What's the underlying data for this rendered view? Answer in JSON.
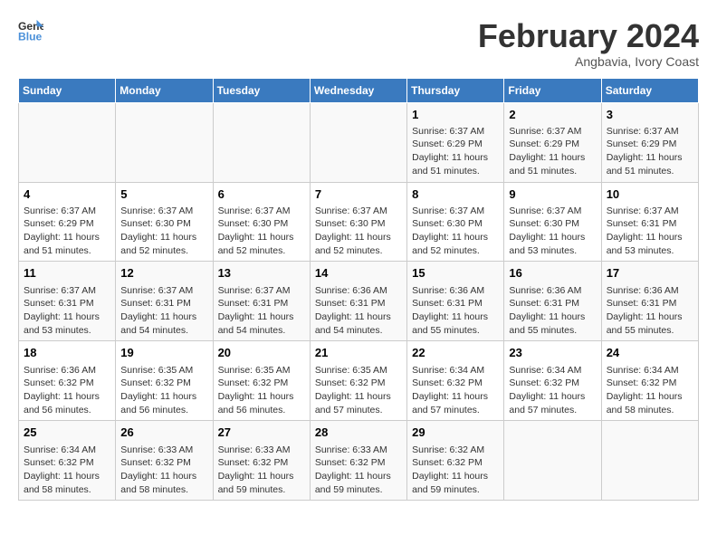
{
  "logo": {
    "line1": "General",
    "line2": "Blue"
  },
  "title": "February 2024",
  "subtitle": "Angbavia, Ivory Coast",
  "days_of_week": [
    "Sunday",
    "Monday",
    "Tuesday",
    "Wednesday",
    "Thursday",
    "Friday",
    "Saturday"
  ],
  "weeks": [
    [
      {
        "day": "",
        "info": ""
      },
      {
        "day": "",
        "info": ""
      },
      {
        "day": "",
        "info": ""
      },
      {
        "day": "",
        "info": ""
      },
      {
        "day": "1",
        "info": "Sunrise: 6:37 AM\nSunset: 6:29 PM\nDaylight: 11 hours and 51 minutes."
      },
      {
        "day": "2",
        "info": "Sunrise: 6:37 AM\nSunset: 6:29 PM\nDaylight: 11 hours and 51 minutes."
      },
      {
        "day": "3",
        "info": "Sunrise: 6:37 AM\nSunset: 6:29 PM\nDaylight: 11 hours and 51 minutes."
      }
    ],
    [
      {
        "day": "4",
        "info": "Sunrise: 6:37 AM\nSunset: 6:29 PM\nDaylight: 11 hours and 51 minutes."
      },
      {
        "day": "5",
        "info": "Sunrise: 6:37 AM\nSunset: 6:30 PM\nDaylight: 11 hours and 52 minutes."
      },
      {
        "day": "6",
        "info": "Sunrise: 6:37 AM\nSunset: 6:30 PM\nDaylight: 11 hours and 52 minutes."
      },
      {
        "day": "7",
        "info": "Sunrise: 6:37 AM\nSunset: 6:30 PM\nDaylight: 11 hours and 52 minutes."
      },
      {
        "day": "8",
        "info": "Sunrise: 6:37 AM\nSunset: 6:30 PM\nDaylight: 11 hours and 52 minutes."
      },
      {
        "day": "9",
        "info": "Sunrise: 6:37 AM\nSunset: 6:30 PM\nDaylight: 11 hours and 53 minutes."
      },
      {
        "day": "10",
        "info": "Sunrise: 6:37 AM\nSunset: 6:31 PM\nDaylight: 11 hours and 53 minutes."
      }
    ],
    [
      {
        "day": "11",
        "info": "Sunrise: 6:37 AM\nSunset: 6:31 PM\nDaylight: 11 hours and 53 minutes."
      },
      {
        "day": "12",
        "info": "Sunrise: 6:37 AM\nSunset: 6:31 PM\nDaylight: 11 hours and 54 minutes."
      },
      {
        "day": "13",
        "info": "Sunrise: 6:37 AM\nSunset: 6:31 PM\nDaylight: 11 hours and 54 minutes."
      },
      {
        "day": "14",
        "info": "Sunrise: 6:36 AM\nSunset: 6:31 PM\nDaylight: 11 hours and 54 minutes."
      },
      {
        "day": "15",
        "info": "Sunrise: 6:36 AM\nSunset: 6:31 PM\nDaylight: 11 hours and 55 minutes."
      },
      {
        "day": "16",
        "info": "Sunrise: 6:36 AM\nSunset: 6:31 PM\nDaylight: 11 hours and 55 minutes."
      },
      {
        "day": "17",
        "info": "Sunrise: 6:36 AM\nSunset: 6:31 PM\nDaylight: 11 hours and 55 minutes."
      }
    ],
    [
      {
        "day": "18",
        "info": "Sunrise: 6:36 AM\nSunset: 6:32 PM\nDaylight: 11 hours and 56 minutes."
      },
      {
        "day": "19",
        "info": "Sunrise: 6:35 AM\nSunset: 6:32 PM\nDaylight: 11 hours and 56 minutes."
      },
      {
        "day": "20",
        "info": "Sunrise: 6:35 AM\nSunset: 6:32 PM\nDaylight: 11 hours and 56 minutes."
      },
      {
        "day": "21",
        "info": "Sunrise: 6:35 AM\nSunset: 6:32 PM\nDaylight: 11 hours and 57 minutes."
      },
      {
        "day": "22",
        "info": "Sunrise: 6:34 AM\nSunset: 6:32 PM\nDaylight: 11 hours and 57 minutes."
      },
      {
        "day": "23",
        "info": "Sunrise: 6:34 AM\nSunset: 6:32 PM\nDaylight: 11 hours and 57 minutes."
      },
      {
        "day": "24",
        "info": "Sunrise: 6:34 AM\nSunset: 6:32 PM\nDaylight: 11 hours and 58 minutes."
      }
    ],
    [
      {
        "day": "25",
        "info": "Sunrise: 6:34 AM\nSunset: 6:32 PM\nDaylight: 11 hours and 58 minutes."
      },
      {
        "day": "26",
        "info": "Sunrise: 6:33 AM\nSunset: 6:32 PM\nDaylight: 11 hours and 58 minutes."
      },
      {
        "day": "27",
        "info": "Sunrise: 6:33 AM\nSunset: 6:32 PM\nDaylight: 11 hours and 59 minutes."
      },
      {
        "day": "28",
        "info": "Sunrise: 6:33 AM\nSunset: 6:32 PM\nDaylight: 11 hours and 59 minutes."
      },
      {
        "day": "29",
        "info": "Sunrise: 6:32 AM\nSunset: 6:32 PM\nDaylight: 11 hours and 59 minutes."
      },
      {
        "day": "",
        "info": ""
      },
      {
        "day": "",
        "info": ""
      }
    ]
  ]
}
